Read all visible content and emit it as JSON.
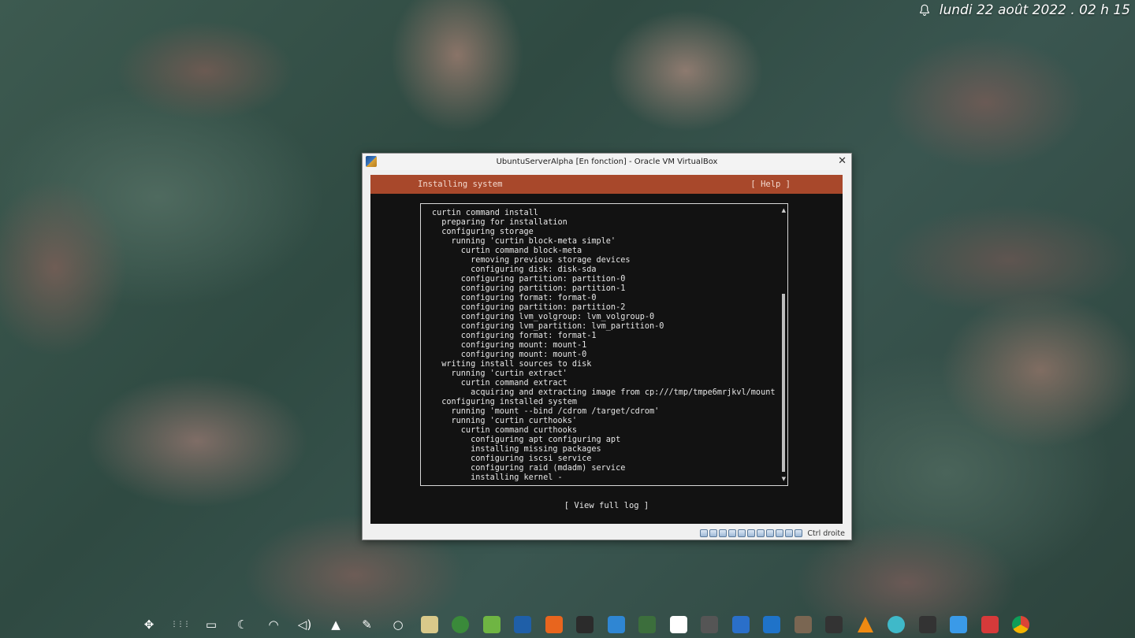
{
  "topbar": {
    "datetime": "lundi 22 août 2022 . 02 h 15"
  },
  "window": {
    "title": "UbuntuServerAlpha [En fonction] - Oracle VM VirtualBox",
    "close_glyph": "✕",
    "host_key": "Ctrl droite"
  },
  "installer": {
    "header_title": "Installing system",
    "help_label": "[ Help ]",
    "view_log_label": "[ View full log ]",
    "log_lines": [
      "curtin command install",
      "  preparing for installation",
      "  configuring storage",
      "    running 'curtin block-meta simple'",
      "      curtin command block-meta",
      "        removing previous storage devices",
      "        configuring disk: disk-sda",
      "      configuring partition: partition-0",
      "      configuring partition: partition-1",
      "      configuring format: format-0",
      "      configuring partition: partition-2",
      "      configuring lvm_volgroup: lvm_volgroup-0",
      "      configuring lvm_partition: lvm_partition-0",
      "      configuring format: format-1",
      "      configuring mount: mount-1",
      "      configuring mount: mount-0",
      "  writing install sources to disk",
      "    running 'curtin extract'",
      "      curtin command extract",
      "        acquiring and extracting image from cp:///tmp/tmpe6mrjkvl/mount",
      "  configuring installed system",
      "    running 'mount --bind /cdrom /target/cdrom'",
      "    running 'curtin curthooks'",
      "      curtin command curthooks",
      "        configuring apt configuring apt",
      "        installing missing packages",
      "        configuring iscsi service",
      "        configuring raid (mdadm) service",
      "        installing kernel -"
    ]
  },
  "status_icons": [
    "hard-disk-icon",
    "optical-drive-icon",
    "audio-icon",
    "network-icon",
    "usb-icon",
    "shared-folders-icon",
    "display-icon",
    "recording-icon",
    "vt-x-icon",
    "mouse-integration-icon",
    "keyboard-icon"
  ],
  "dock": [
    {
      "name": "move-arrows-icon",
      "color": "#ffffff"
    },
    {
      "name": "app-grid-icon",
      "color": "#ffffff"
    },
    {
      "name": "show-desktop-icon",
      "color": "#ffffff"
    },
    {
      "name": "night-light-icon",
      "color": "#ffffff"
    },
    {
      "name": "wifi-icon",
      "color": "#ffffff"
    },
    {
      "name": "volume-icon",
      "color": "#ffffff"
    },
    {
      "name": "tray-arrow-icon",
      "color": "#ffffff"
    },
    {
      "name": "pen-icon",
      "color": "#ffffff"
    },
    {
      "name": "circle-icon",
      "color": "#ffffff"
    },
    {
      "name": "file-manager-icon",
      "color": "#d9c98a"
    },
    {
      "name": "globe-app-icon",
      "color": "#3a8a3a"
    },
    {
      "name": "green-lock-app-icon",
      "color": "#6fb543"
    },
    {
      "name": "virtualbox-icon",
      "color": "#1f5fa8"
    },
    {
      "name": "orange-app-icon",
      "color": "#e8651e"
    },
    {
      "name": "terminal-icon",
      "color": "#2b2b2b"
    },
    {
      "name": "blue-folder-icon",
      "color": "#2f86d3"
    },
    {
      "name": "system-monitor-icon",
      "color": "#3c6e3c"
    },
    {
      "name": "font-viewer-icon",
      "color": "#ffffff"
    },
    {
      "name": "calculator-icon",
      "color": "#555555"
    },
    {
      "name": "house-app-icon",
      "color": "#2a6fc9"
    },
    {
      "name": "writer-icon",
      "color": "#1f73c9"
    },
    {
      "name": "gimp-icon",
      "color": "#7a6652"
    },
    {
      "name": "diamond-app-icon",
      "color": "#333333"
    },
    {
      "name": "vlc-icon",
      "color": "#f08a12"
    },
    {
      "name": "mail-icon",
      "color": "#3fb9c9"
    },
    {
      "name": "console-icon",
      "color": "#333333"
    },
    {
      "name": "airplane-app-icon",
      "color": "#3a9ae8"
    },
    {
      "name": "red-app-icon",
      "color": "#d63a3a"
    },
    {
      "name": "chrome-icon",
      "color": "#e8a81c"
    }
  ]
}
